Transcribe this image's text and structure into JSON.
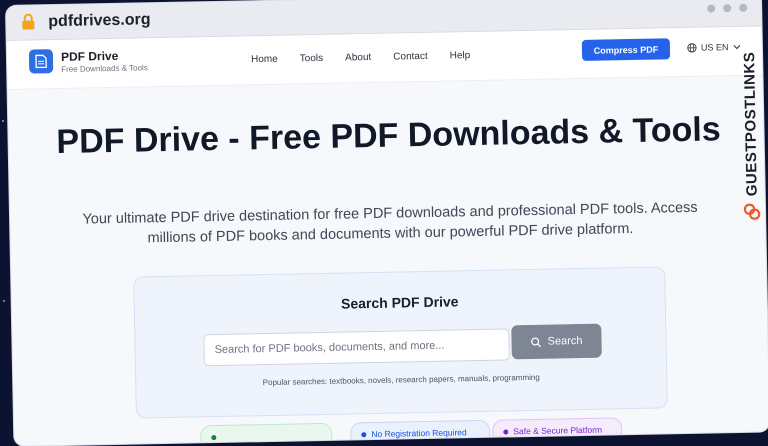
{
  "browser": {
    "url": "pdfdrives.org"
  },
  "nav": {
    "brand": "PDF Drive",
    "tagline": "Free Downloads & Tools",
    "links": [
      "Home",
      "Tools",
      "About",
      "Contact",
      "Help"
    ],
    "cta_label": "Compress PDF",
    "language": "US EN"
  },
  "hero": {
    "title": "PDF Drive - Free PDF Downloads & Tools",
    "subtitle": "Your ultimate PDF drive destination for free PDF downloads and professional PDF tools. Access millions of PDF books and documents with our powerful PDF drive platform."
  },
  "search": {
    "title": "Search PDF Drive",
    "placeholder": "Search for PDF books, documents, and more...",
    "button_label": "Search",
    "popular": "Popular searches: textbooks, novels, research papers, manuals, programming"
  },
  "badges": {
    "b1": "",
    "b2": "No Registration Required",
    "b3": "Safe & Secure Platform"
  },
  "watermark": {
    "text": "GUESTPOSTLINKS"
  },
  "colors": {
    "accent": "#2563eb",
    "search_button": "#7e8593",
    "background": "#0b1330"
  }
}
